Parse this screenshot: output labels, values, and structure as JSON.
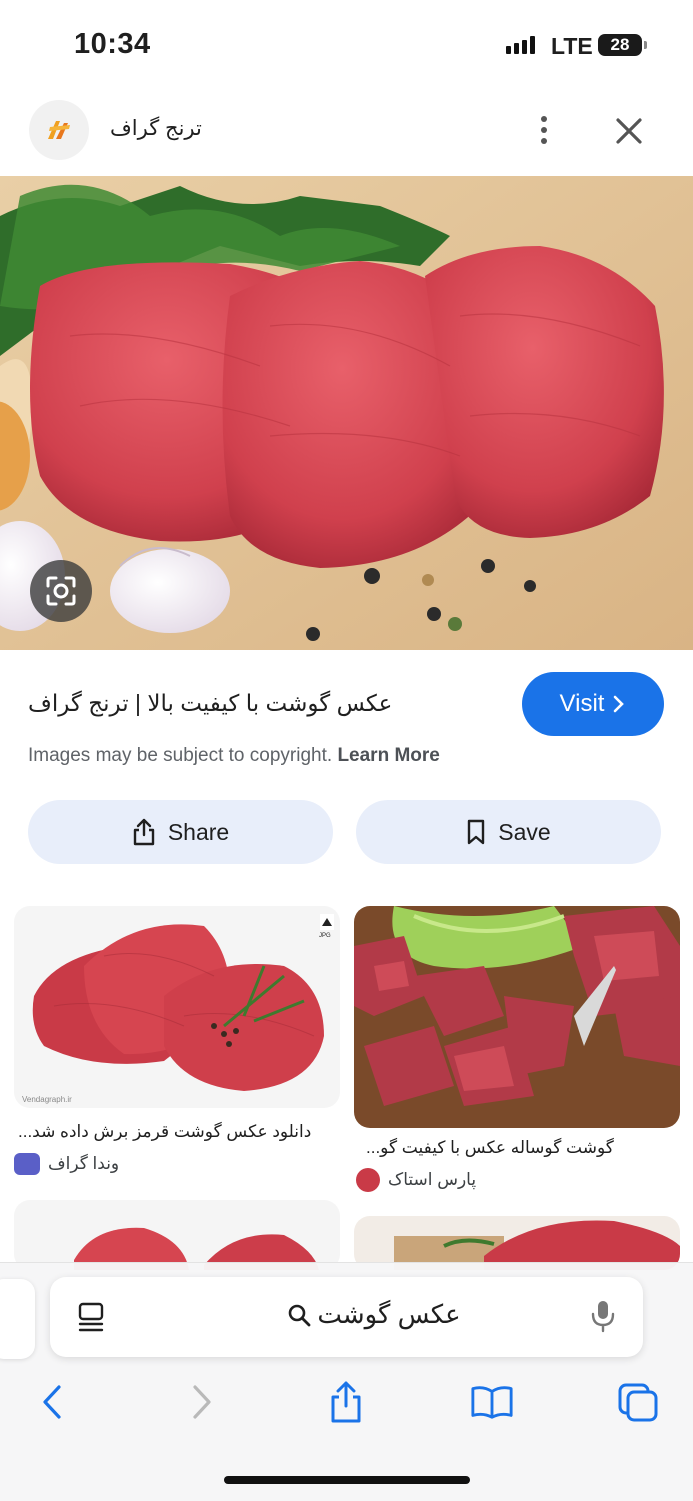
{
  "status": {
    "time": "10:34",
    "network": "LTE",
    "battery": "28"
  },
  "header": {
    "site_name": "ترنج گراف"
  },
  "result": {
    "title": "عکس گوشت با کیفیت بالا | ترنج گراف",
    "visit_label": "Visit",
    "copyright_text": "Images may be subject to copyright.",
    "learn_more": "Learn More"
  },
  "actions": {
    "share_label": "Share",
    "save_label": "Save"
  },
  "related": [
    {
      "caption": "دانلود عکس گوشت قرمز برش داده شد...",
      "source": "وندا گراف",
      "badge": "JPG",
      "watermark": "Vendagraph.ir"
    },
    {
      "caption": "گوشت گوساله عکس با کیفیت گو...",
      "source": "پارس استاک"
    }
  ],
  "address_bar": {
    "query": "عکس گوشت"
  },
  "colors": {
    "accent": "#1a73e8",
    "action_bg": "#e8eefa",
    "meat": "#d64550"
  },
  "icons": [
    "more-vert-icon",
    "close-icon",
    "lens-icon",
    "chevron-right-icon",
    "share-icon",
    "bookmark-icon",
    "reader-icon",
    "search-icon",
    "mic-icon",
    "back-icon",
    "forward-icon",
    "share-sheet-icon",
    "bookmarks-icon",
    "tabs-icon"
  ]
}
